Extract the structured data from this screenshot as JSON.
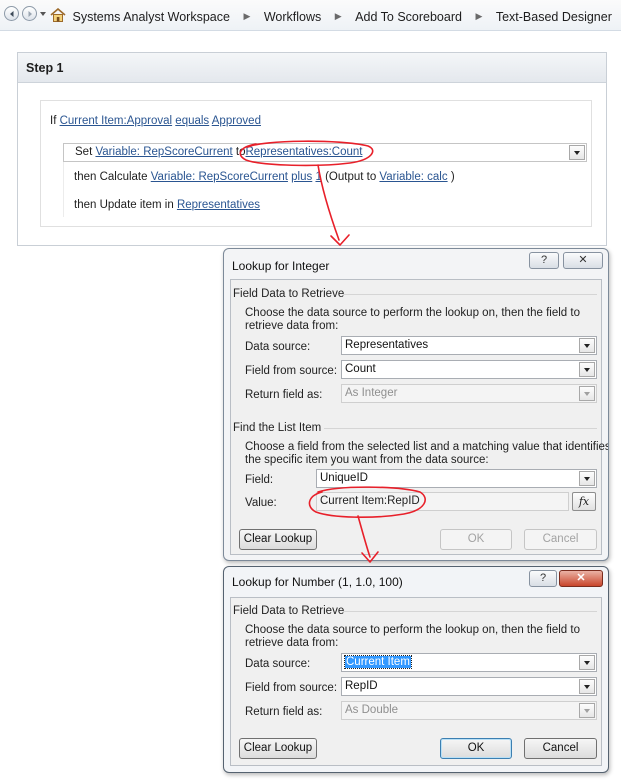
{
  "breadcrumb": {
    "items": [
      "Systems Analyst Workspace",
      "Workflows",
      "Add To Scoreboard",
      "Text-Based Designer"
    ]
  },
  "step": {
    "title": "Step 1",
    "condition": {
      "if_word": "If",
      "field": "Current Item:Approval",
      "operator": "equals",
      "value": "Approved"
    },
    "set_action": {
      "set_word": "Set",
      "variable": "Variable: RepScoreCurrent",
      "to_word": "to",
      "source": "Representatives:Count"
    },
    "calc_action": {
      "prefix": "then Calculate",
      "variable": "Variable: RepScoreCurrent",
      "operator": "plus",
      "operand": "1",
      "output_prefix": "(Output to",
      "output": "Variable: calc",
      "close": ")"
    },
    "update_action": {
      "prefix": "then Update item in",
      "list": "Representatives"
    }
  },
  "dialog1": {
    "title": "Lookup for Integer",
    "help": "?",
    "close": "✕",
    "group1": "Field Data to Retrieve",
    "desc1": "Choose the data source to perform the lookup on, then the field to",
    "desc1b": "retrieve data from:",
    "data_source_label": "Data source:",
    "data_source": "Representatives",
    "field_from_source_label": "Field from source:",
    "field_from_source": "Count",
    "return_as_label": "Return field as:",
    "return_as": "As Integer",
    "group2": "Find the List Item",
    "desc2": "Choose a field from the selected list and a matching value that identifies",
    "desc2b": "the specific item you want from the data source:",
    "field_label": "Field:",
    "field": "UniqueID",
    "value_label": "Value:",
    "value": "Current Item:RepID",
    "fx": "fx",
    "clear": "Clear Lookup",
    "ok": "OK",
    "cancel": "Cancel"
  },
  "dialog2": {
    "title": "Lookup for Number (1, 1.0, 100)",
    "help": "?",
    "close": "✕",
    "group1": "Field Data to Retrieve",
    "desc1": "Choose the data source to perform the lookup on, then the field to",
    "desc1b": "retrieve data from:",
    "data_source_label": "Data source:",
    "data_source": "Current Item",
    "field_from_source_label": "Field from source:",
    "field_from_source": "RepID",
    "return_as_label": "Return field as:",
    "return_as": "As Double",
    "clear": "Clear Lookup",
    "ok": "OK",
    "cancel": "Cancel"
  },
  "colors": {
    "annotation": "#e8202a",
    "link": "#2a5591",
    "selection": "#3399ff"
  },
  "icons": [
    "back-icon",
    "forward-icon",
    "history-dropdown-icon",
    "home-icon",
    "breadcrumb-separator-icon",
    "dropdown-arrow-icon",
    "function-icon",
    "help-icon",
    "close-icon"
  ]
}
